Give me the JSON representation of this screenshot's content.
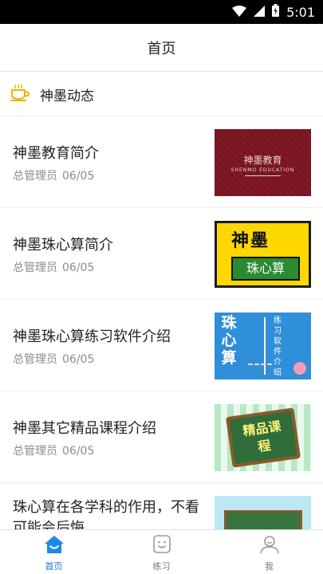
{
  "status_bar": {
    "time": "5:01"
  },
  "header": {
    "title": "首页"
  },
  "section": {
    "title": "神墨动态"
  },
  "news": [
    {
      "title": "神墨教育简介",
      "author": "总管理员",
      "date": "06/05",
      "thumb_title": "神墨教育",
      "thumb_sub": "SHENMO EDUCATION"
    },
    {
      "title": "神墨珠心算简介",
      "author": "总管理员",
      "date": "06/05",
      "thumb_title": "神墨",
      "thumb_box": "珠心算"
    },
    {
      "title": "神墨珠心算练习软件介绍",
      "author": "总管理员",
      "date": "06/05",
      "thumb_left": "珠心算",
      "thumb_right": "练习软件介绍"
    },
    {
      "title": "神墨其它精品课程介绍",
      "author": "总管理员",
      "date": "06/05",
      "thumb_text": "精品课程"
    },
    {
      "title": "珠心算在各学科的作用，不看可能会后悔"
    }
  ],
  "tabs": [
    {
      "label": "首页",
      "icon": "home-icon",
      "active": true
    },
    {
      "label": "练习",
      "icon": "practice-icon",
      "active": false
    },
    {
      "label": "我",
      "icon": "profile-icon",
      "active": false
    }
  ],
  "colors": {
    "accent": "#1976d2",
    "cup": "#f0b400",
    "thumb1": "#7a1420",
    "thumb2": "#ffd700",
    "thumb3": "#2f8fd8"
  }
}
